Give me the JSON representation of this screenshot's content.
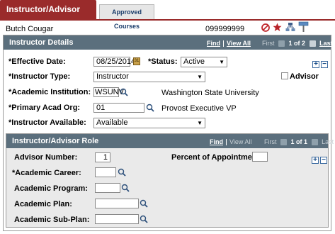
{
  "tabs": {
    "active": "Instructor/Advisor Table",
    "inactive": "Approved Courses"
  },
  "person": {
    "name": "Butch Cougar",
    "id": "099999999"
  },
  "instructor_details": {
    "title": "Instructor Details",
    "find": "Find",
    "view_all": "View All",
    "first": "First",
    "pager": "1 of 2",
    "last": "Last",
    "effective_date_label": "*Effective Date:",
    "effective_date_value": "08/25/2014",
    "status_label": "*Status:",
    "status_value": "Active",
    "instructor_type_label": "*Instructor Type:",
    "instructor_type_value": "Instructor",
    "advisor_label": "Advisor",
    "academic_institution_label": "*Academic Institution:",
    "academic_institution_value": "WSUNV",
    "academic_institution_desc": "Washington State University",
    "primary_acad_org_label": "*Primary Acad Org:",
    "primary_acad_org_value": "01",
    "primary_acad_org_desc": "Provost Executive VP",
    "instructor_available_label": "*Instructor Available:",
    "instructor_available_value": "Available"
  },
  "role": {
    "title": "Instructor/Advisor Role",
    "find": "Find",
    "view_all": "View All",
    "first": "First",
    "pager": "1 of 1",
    "last": "Last",
    "advisor_number_label": "Advisor Number:",
    "advisor_number_value": "1",
    "percent_label": "Percent of Appointment:",
    "percent_value": "",
    "academic_career_label": "*Academic Career:",
    "academic_program_label": "Academic Program:",
    "academic_plan_label": "Academic Plan:",
    "academic_subplan_label": "Academic Sub-Plan:"
  },
  "colors": {
    "tab": "#9a2b2b",
    "section_bar": "#5b6f7d",
    "link": "#1a3d6b"
  },
  "icons": [
    "no-entry-icon",
    "favorite-star-icon",
    "org-chart-icon",
    "signpost-icon",
    "calendar-icon",
    "lookup-icon",
    "plus-icon",
    "minus-icon"
  ]
}
